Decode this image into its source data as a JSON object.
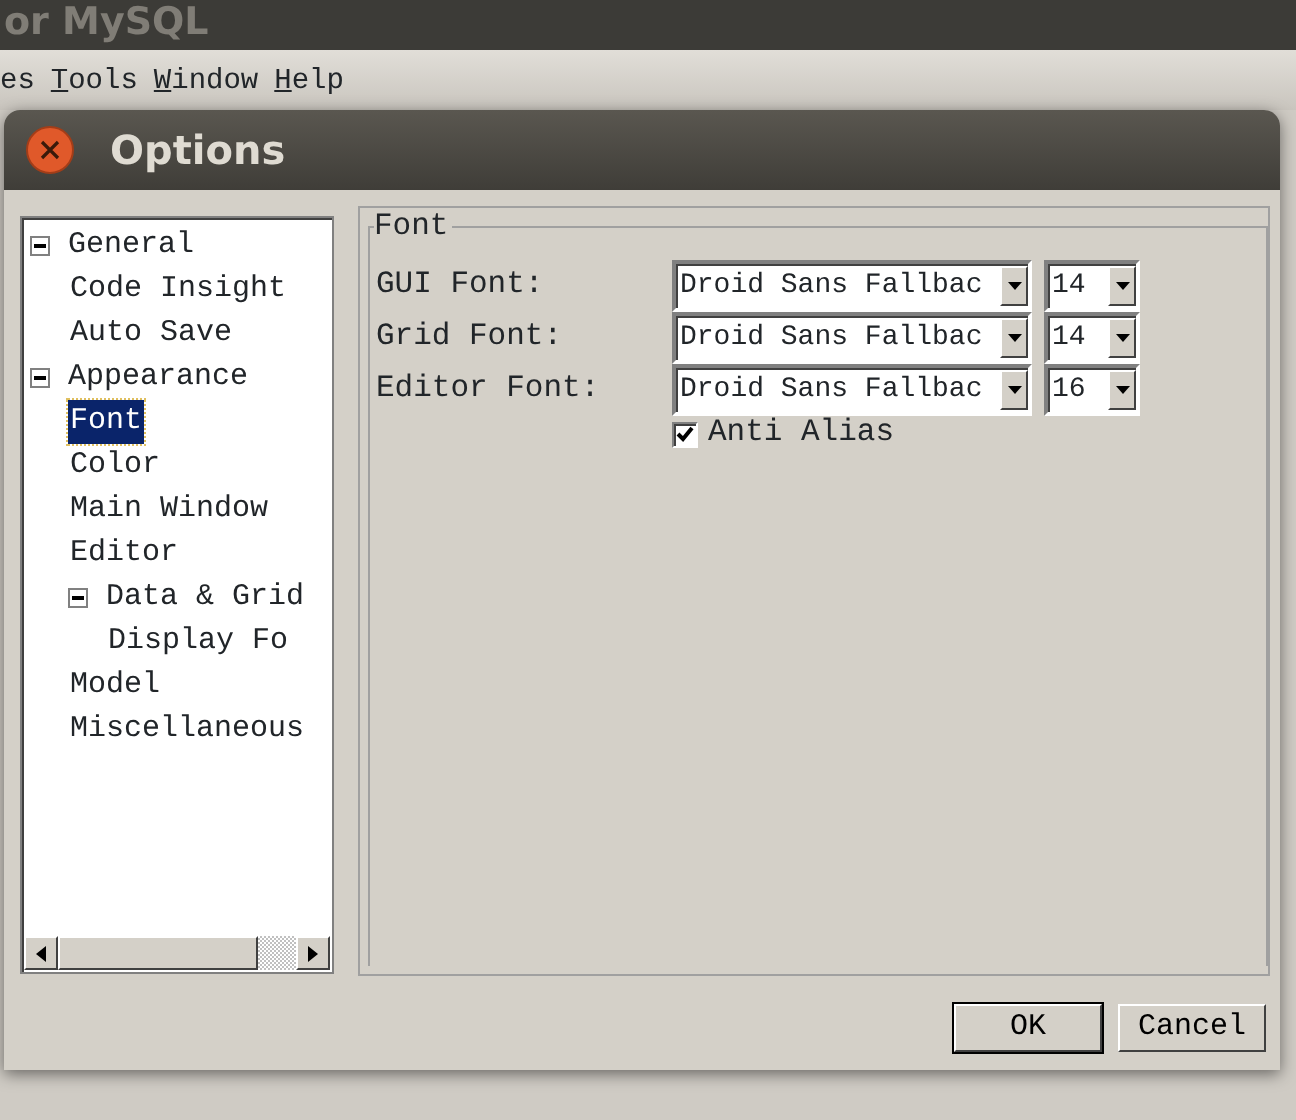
{
  "app": {
    "title": "or MySQL"
  },
  "menu": [
    {
      "label": "es",
      "mnemonic": false
    },
    {
      "label": "Tools",
      "mnemonic": true
    },
    {
      "label": "Window",
      "mnemonic": true
    },
    {
      "label": "Help",
      "mnemonic": true
    }
  ],
  "dialog": {
    "title": "Options",
    "tree": [
      {
        "label": "General",
        "selected": false,
        "expanded": true,
        "children": [
          {
            "label": "Code Insight",
            "selected": false
          },
          {
            "label": "Auto Save",
            "selected": false
          }
        ]
      },
      {
        "label": "Appearance",
        "selected": false,
        "expanded": true,
        "children": [
          {
            "label": "Font",
            "selected": true
          },
          {
            "label": "Color",
            "selected": false
          },
          {
            "label": "Main Window",
            "selected": false
          },
          {
            "label": "Editor",
            "selected": false
          },
          {
            "label": "Data & Grid",
            "selected": false,
            "expanded": true,
            "children": [
              {
                "label": "Display Fo",
                "selected": false
              }
            ]
          }
        ]
      },
      {
        "label": "Model",
        "selected": false
      },
      {
        "label": "Miscellaneous",
        "selected": false
      }
    ],
    "group": {
      "title": "Font",
      "rows": [
        {
          "label": "GUI Font:",
          "font": "Droid Sans Fallbac",
          "size": "14"
        },
        {
          "label": "Grid Font:",
          "font": "Droid Sans Fallbac",
          "size": "14"
        },
        {
          "label": "Editor Font:",
          "font": "Droid Sans Fallbac",
          "size": "16"
        }
      ],
      "checkbox": {
        "label": "Anti Alias",
        "checked": true
      }
    },
    "buttons": [
      {
        "label": "OK",
        "default": true
      },
      {
        "label": "Cancel",
        "default": false
      }
    ]
  }
}
